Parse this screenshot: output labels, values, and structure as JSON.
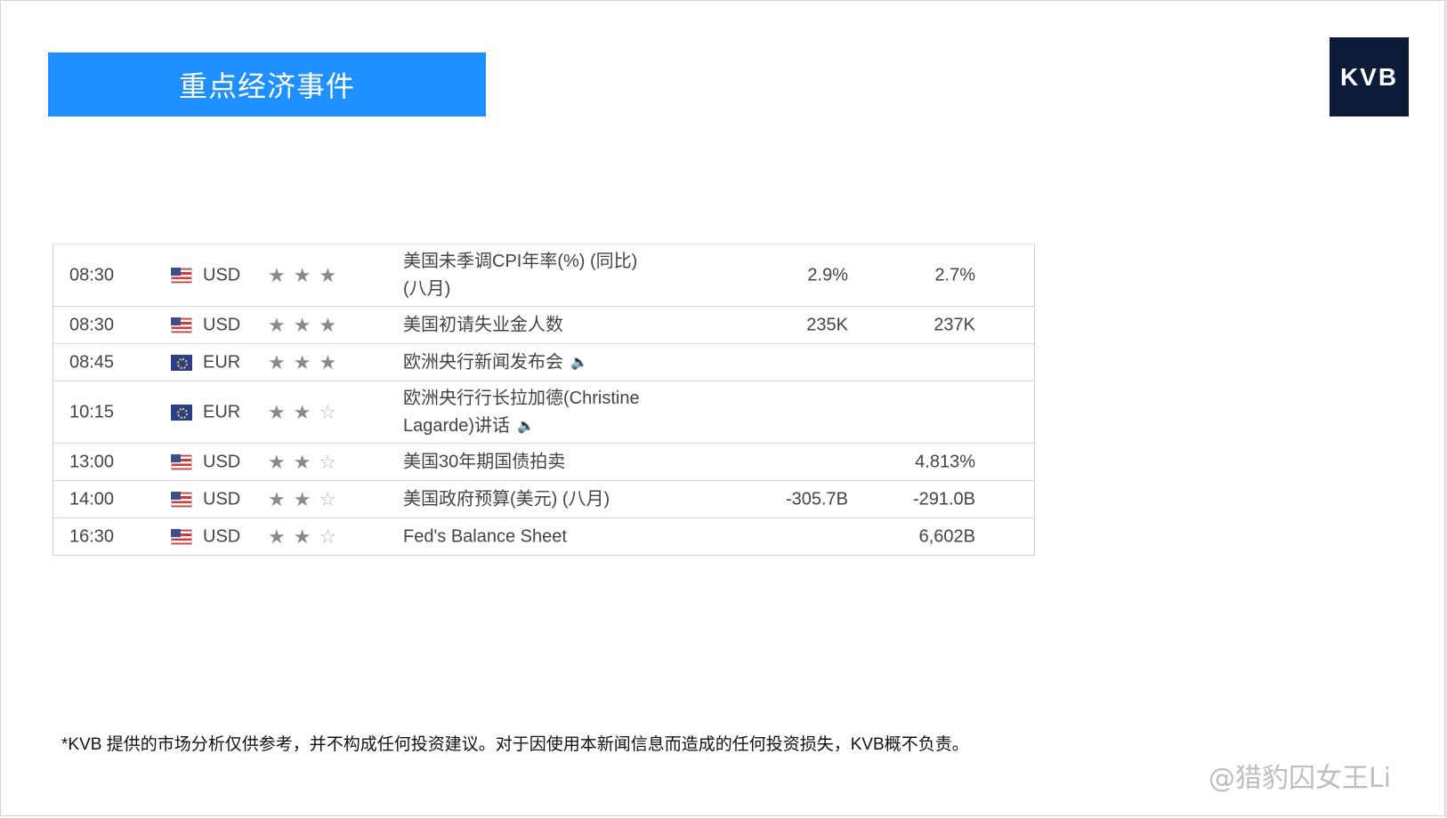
{
  "banner": {
    "title": "重点经济事件"
  },
  "logo": {
    "text": "KVB"
  },
  "calendar": {
    "rows": [
      {
        "time": "08:30",
        "flag": "us-flag-icon",
        "currency": "USD",
        "stars": 3,
        "event_line1": "美国未季调CPI年率(%) (同比)",
        "event_line2": "(八月)",
        "previous": "2.9%",
        "forecast": "2.7%"
      },
      {
        "time": "08:30",
        "flag": "us-flag-icon",
        "currency": "USD",
        "stars": 3,
        "event_line1": "美国初请失业金人数",
        "event_line2": "",
        "previous": "235K",
        "forecast": "237K"
      },
      {
        "time": "08:45",
        "flag": "eu-flag-icon",
        "currency": "EUR",
        "stars": 3,
        "event_line1": "欧洲央行新闻发布会",
        "event_line2": "",
        "speaker": true,
        "previous": "",
        "forecast": ""
      },
      {
        "time": "10:15",
        "flag": "eu-flag-icon",
        "currency": "EUR",
        "stars": 2,
        "event_line1": "欧洲央行行长拉加德(Christine",
        "event_line2": "Lagarde)讲话",
        "speaker": true,
        "previous": "",
        "forecast": ""
      },
      {
        "time": "13:00",
        "flag": "us-flag-icon",
        "currency": "USD",
        "stars": 2,
        "event_line1": "美国30年期国债拍卖",
        "event_line2": "",
        "previous": "",
        "forecast": "4.813%"
      },
      {
        "time": "14:00",
        "flag": "us-flag-icon",
        "currency": "USD",
        "stars": 2,
        "event_line1": "美国政府预算(美元) (八月)",
        "event_line2": "",
        "previous": "-305.7B",
        "forecast": "-291.0B"
      },
      {
        "time": "16:30",
        "flag": "us-flag-icon",
        "currency": "USD",
        "stars": 2,
        "event_line1": "Fed's Balance Sheet",
        "event_line2": "",
        "previous": "",
        "forecast": "6,602B"
      }
    ]
  },
  "disclaimer": {
    "text": "*KVB 提供的市场分析仅供参考，并不构成任何投资建议。对于因使用本新闻信息而造成的任何投资损失，KVB概不负责。"
  },
  "watermark": {
    "text": "@猎豹囚女王Li"
  }
}
